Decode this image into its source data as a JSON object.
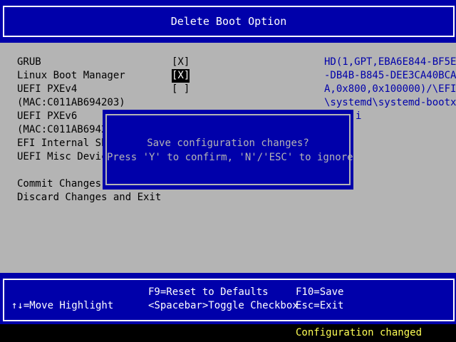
{
  "header": {
    "title": "Delete Boot Option"
  },
  "options": [
    {
      "label": "GRUB",
      "checkbox": "[X]",
      "selected": false
    },
    {
      "label": "Linux Boot Manager",
      "checkbox": "[X]",
      "selected": true
    },
    {
      "label": "UEFI PXEv4",
      "checkbox": "[ ]",
      "selected": false
    },
    {
      "label": "(MAC:C011AB694203)"
    },
    {
      "label": "UEFI PXEv6"
    },
    {
      "label": "(MAC:C011AB6942"
    },
    {
      "label": "EFI Internal Sh"
    },
    {
      "label": "UEFI Misc Devic"
    }
  ],
  "actions": {
    "commit": "Commit Changes",
    "discard": "Discard Changes and Exit"
  },
  "device_path": [
    "HD(1,GPT,EBA6E844-BF5E",
    "-DB4B-B845-DEE3CA40BCA",
    "A,0x800,0x100000)/\\EFI",
    "\\systemd\\systemd-bootx",
    "i"
  ],
  "dialog": {
    "message": "Save configuration changes?",
    "instructions": "Press 'Y' to confirm, 'N'/'ESC' to ignore."
  },
  "help": {
    "move": "↑↓=Move Highlight",
    "reset": "F9=Reset to Defaults",
    "toggle": "<Spacebar>Toggle Checkbox",
    "save": "F10=Save",
    "exit": "Esc=Exit"
  },
  "status": {
    "text": "Configuration changed"
  },
  "colors": {
    "background": "#b4b4b4",
    "bar_blue": "#0000aa",
    "text": "#000000",
    "status_yellow": "#ffff55"
  }
}
